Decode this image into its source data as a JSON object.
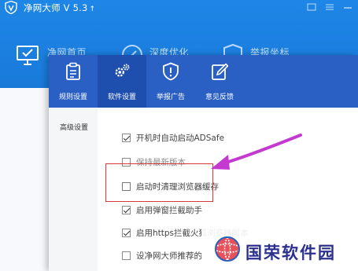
{
  "app": {
    "title": "净网大师 V 5.3",
    "update_arrow": "↑",
    "nav": [
      {
        "label": "净网首页",
        "icon": "monitor-icon"
      },
      {
        "label": "深度优化",
        "icon": "rocket-icon"
      },
      {
        "label": "举报坐标",
        "icon": "shield-icon"
      }
    ]
  },
  "dialog": {
    "tabs": [
      {
        "label": "规则设置",
        "icon": "clipboard-icon",
        "active": false
      },
      {
        "label": "软件设置",
        "icon": "gears-icon",
        "active": true
      },
      {
        "label": "举报广告",
        "icon": "shield-alert-icon",
        "active": false
      },
      {
        "label": "意见反馈",
        "icon": "edit-icon",
        "active": false
      }
    ],
    "sidebar": {
      "items": [
        {
          "label": "高级设置"
        }
      ]
    },
    "options": [
      {
        "label": "开机时自动启动ADSafe",
        "checked": true
      },
      {
        "label": "保持最新版本",
        "checked": false
      },
      {
        "label": "启动时清理浏览器缓存",
        "checked": false,
        "highlighted": true
      },
      {
        "label": "启用弹窗拦截助手",
        "checked": true
      },
      {
        "label": "启用https拦截火狐浏览器脚本",
        "checked": true
      },
      {
        "label": "设净网大师推荐的",
        "checked": false
      }
    ]
  },
  "annotation": {
    "box_color": "#d33a3a",
    "arrow_color": "#c43ad0"
  },
  "watermark": {
    "text": "国荣软件园"
  },
  "colors": {
    "header_blue": "#1b7fe0",
    "dialog_tab_blue": "#2a5fc4",
    "dialog_tab_active": "#1f4fae"
  }
}
